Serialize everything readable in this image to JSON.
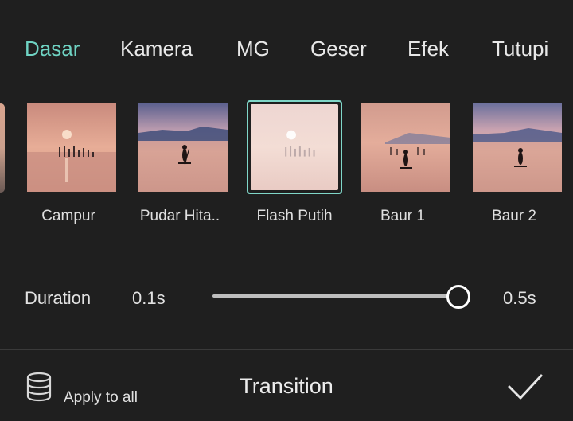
{
  "tabs": [
    {
      "label": "Dasar",
      "active": true
    },
    {
      "label": "Kamera",
      "active": false
    },
    {
      "label": "MG",
      "active": false
    },
    {
      "label": "Geser",
      "active": false
    },
    {
      "label": "Efek",
      "active": false
    },
    {
      "label": "Tutupi",
      "active": false
    }
  ],
  "transitions": [
    {
      "label": "Campur",
      "selected": false
    },
    {
      "label": "Pudar Hita..",
      "selected": false
    },
    {
      "label": "Flash Putih",
      "selected": true
    },
    {
      "label": "Baur 1",
      "selected": false
    },
    {
      "label": "Baur 2",
      "selected": false
    }
  ],
  "duration": {
    "label": "Duration",
    "min_label": "0.1s",
    "max_label": "0.5s",
    "value_fraction": 1.0
  },
  "bottom": {
    "apply_label": "Apply to all",
    "apply_icon": "database-icon",
    "title": "Transition",
    "confirm_icon": "checkmark-icon"
  },
  "colors": {
    "accent": "#6fd3c3",
    "background": "#1f1f1f"
  }
}
